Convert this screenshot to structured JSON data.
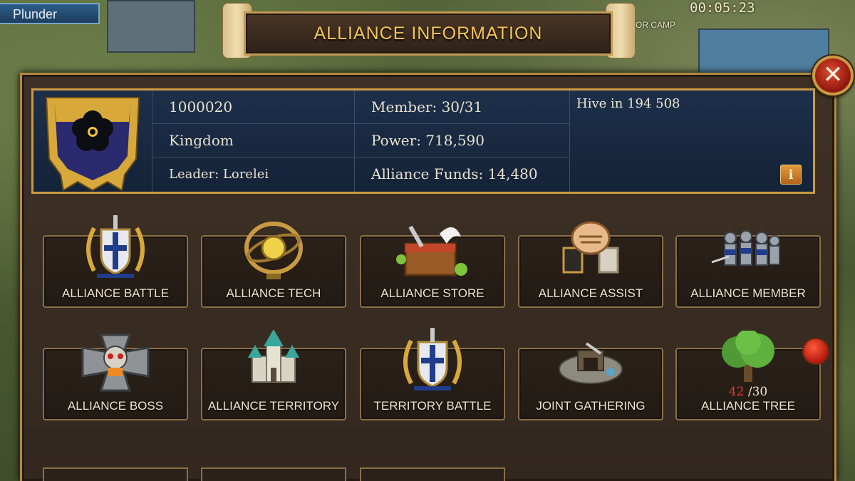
{
  "hud": {
    "plunder_label": "Plunder",
    "timer": "00:05:23",
    "camp_label": "RIOR CAMP"
  },
  "dialog": {
    "title": "ALLIANCE INFORMATION",
    "close_icon": "close-icon"
  },
  "alliance": {
    "id": "1000020",
    "name": "Kingdom",
    "leader": "Leader: Lorelei",
    "members": "Member: 30/31",
    "power": "Power: 718,590",
    "funds": "Alliance Funds: 14,480",
    "notice": "Hive in 194 508",
    "info_button": "i",
    "crest_colors": {
      "shield": "#2b2a6e",
      "rim": "#d8a93a",
      "flower": "#0d0d14"
    }
  },
  "features": [
    {
      "label": "ALLIANCE BATTLE",
      "icon": "shield-laurel-icon"
    },
    {
      "label": "ALLIANCE TECH",
      "icon": "armillary-sphere-icon"
    },
    {
      "label": "ALLIANCE STORE",
      "icon": "treasure-chest-icon"
    },
    {
      "label": "ALLIANCE ASSIST",
      "icon": "handshake-icon"
    },
    {
      "label": "ALLIANCE MEMBER",
      "icon": "soldiers-icon"
    },
    {
      "label": "ALLIANCE BOSS",
      "icon": "skull-cross-icon"
    },
    {
      "label": "ALLIANCE TERRITORY",
      "icon": "castle-icon"
    },
    {
      "label": "TERRITORY BATTLE",
      "icon": "shield-laurel-icon"
    },
    {
      "label": "JOINT GATHERING",
      "icon": "mine-icon"
    },
    {
      "label": "ALLIANCE TREE",
      "icon": "tree-icon",
      "count_current": "42",
      "count_max": "/30"
    }
  ],
  "colors": {
    "accent_gold": "#f4c558",
    "panel": "#332820",
    "info_bg": "#1d2f4a",
    "alert": "#e23b2b"
  }
}
